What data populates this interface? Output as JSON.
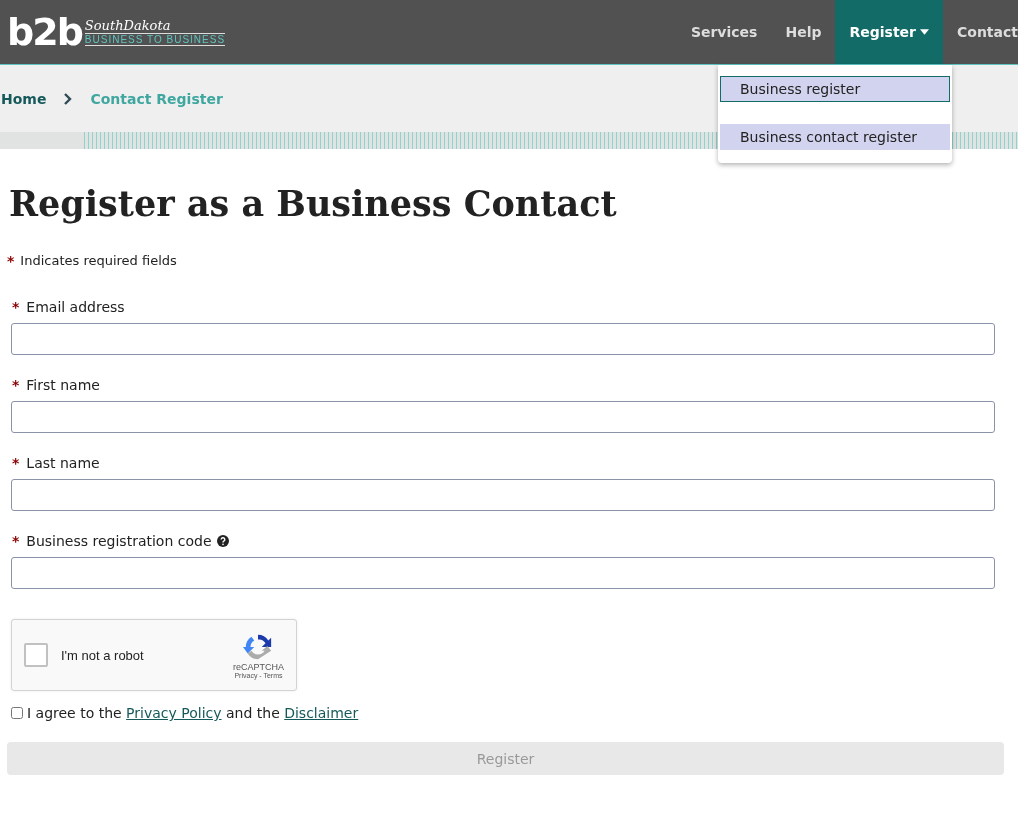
{
  "logo": {
    "mark": "b2b",
    "script": "SouthDakota",
    "tagline": "BUSINESS TO BUSINESS"
  },
  "nav": [
    {
      "label": "Services",
      "selected": false,
      "dropdown": false
    },
    {
      "label": "Help",
      "selected": false,
      "dropdown": false
    },
    {
      "label": "Register",
      "selected": true,
      "dropdown": true
    },
    {
      "label": "Contact",
      "selected": false,
      "dropdown": false
    }
  ],
  "dropdown_menu": [
    {
      "label": "Business register",
      "focused": true
    },
    {
      "label": "Business contact register",
      "focused": false
    }
  ],
  "breadcrumb": [
    {
      "label": "Home",
      "current": false
    },
    {
      "label": "Contact Register",
      "current": true
    }
  ],
  "heading": "Register as a Business Contact",
  "required_note": {
    "mark": "*",
    "text": "Indicates required fields"
  },
  "fields": [
    {
      "label": "Email address",
      "required": true,
      "help": false
    },
    {
      "label": "First name",
      "required": true,
      "help": false
    },
    {
      "label": "Last name",
      "required": true,
      "help": false
    },
    {
      "label": "Business registration code",
      "required": true,
      "help": true
    }
  ],
  "captcha": {
    "label": "I'm not a robot",
    "checked": false,
    "brand": "reCAPTCHA",
    "links": "Privacy - Terms"
  },
  "agreement": {
    "checked": false,
    "parts": [
      {
        "kind": "text",
        "text": "I agree to the"
      },
      {
        "kind": "link",
        "text": "Privacy Policy"
      },
      {
        "kind": "text",
        "text": "and the"
      },
      {
        "kind": "link",
        "text": "Disclaimer"
      }
    ]
  },
  "submit": {
    "label": "Register",
    "disabled": true
  }
}
